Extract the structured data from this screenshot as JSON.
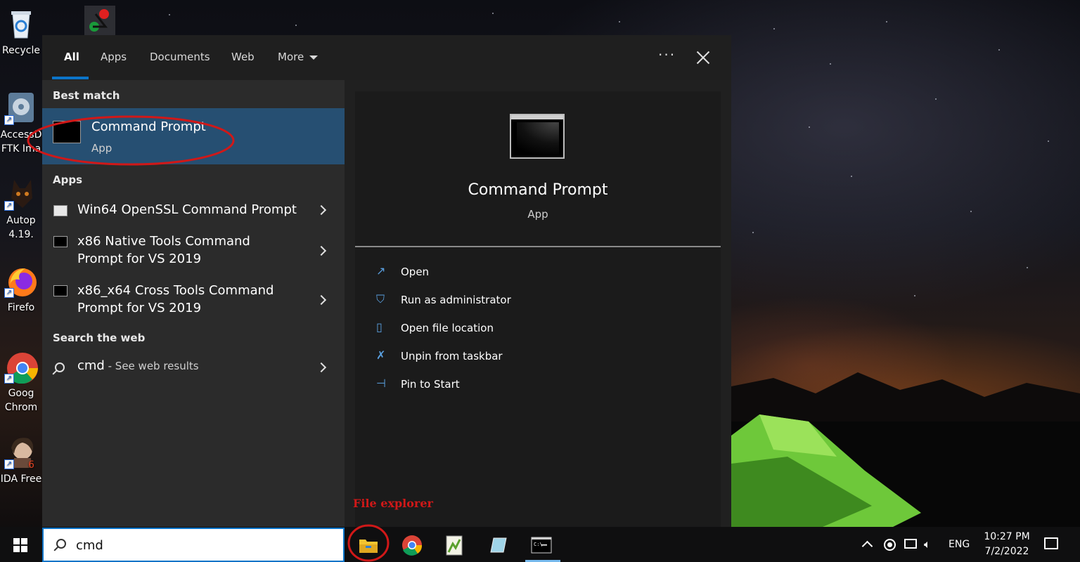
{
  "desktop_icons": [
    {
      "label": "Recycle",
      "label2": "",
      "icon": "recycle-bin-icon"
    },
    {
      "label": "AccessD",
      "label2": "FTK Ima",
      "icon": "ftk-imager-icon"
    },
    {
      "label": "Autop",
      "label2": "4.19.",
      "icon": "autopsy-icon"
    },
    {
      "label": "Firefo",
      "label2": "",
      "icon": "firefox-icon"
    },
    {
      "label": "Goog",
      "label2": "Chrom",
      "icon": "chrome-icon"
    },
    {
      "label": "IDA Free",
      "label2": "",
      "icon": "ida-free-icon"
    }
  ],
  "search": {
    "tabs": [
      {
        "label": "All",
        "active": true
      },
      {
        "label": "Apps",
        "active": false
      },
      {
        "label": "Documents",
        "active": false
      },
      {
        "label": "Web",
        "active": false
      },
      {
        "label": "More",
        "active": false
      }
    ],
    "best_match": {
      "heading": "Best match",
      "title": "Command Prompt",
      "subtitle": "App"
    },
    "apps_heading": "Apps",
    "apps": [
      {
        "name": "Win64 OpenSSL Command Prompt"
      },
      {
        "name": "x86 Native Tools Command Prompt for VS 2019"
      },
      {
        "name": "x86_x64 Cross Tools Command Prompt for VS 2019"
      }
    ],
    "web_heading": "Search the web",
    "web": {
      "query": "cmd",
      "suffix": " - See web results"
    },
    "query_value": "cmd"
  },
  "preview": {
    "title": "Command Prompt",
    "subtitle": "App",
    "actions": [
      {
        "label": "Open",
        "icon": "open-icon"
      },
      {
        "label": "Run as administrator",
        "icon": "shield-icon"
      },
      {
        "label": "Open file location",
        "icon": "folder-location-icon"
      },
      {
        "label": "Unpin from taskbar",
        "icon": "unpin-icon"
      },
      {
        "label": "Pin to Start",
        "icon": "pin-icon"
      }
    ]
  },
  "annotation": "File explorer",
  "tray": {
    "language": "ENG",
    "time": "10:27 PM",
    "date": "7/2/2022"
  },
  "colors": {
    "accent": "#0b74c8",
    "highlight": "#264f72",
    "annotation": "#d01818",
    "action_icon": "#5aa0e0"
  }
}
